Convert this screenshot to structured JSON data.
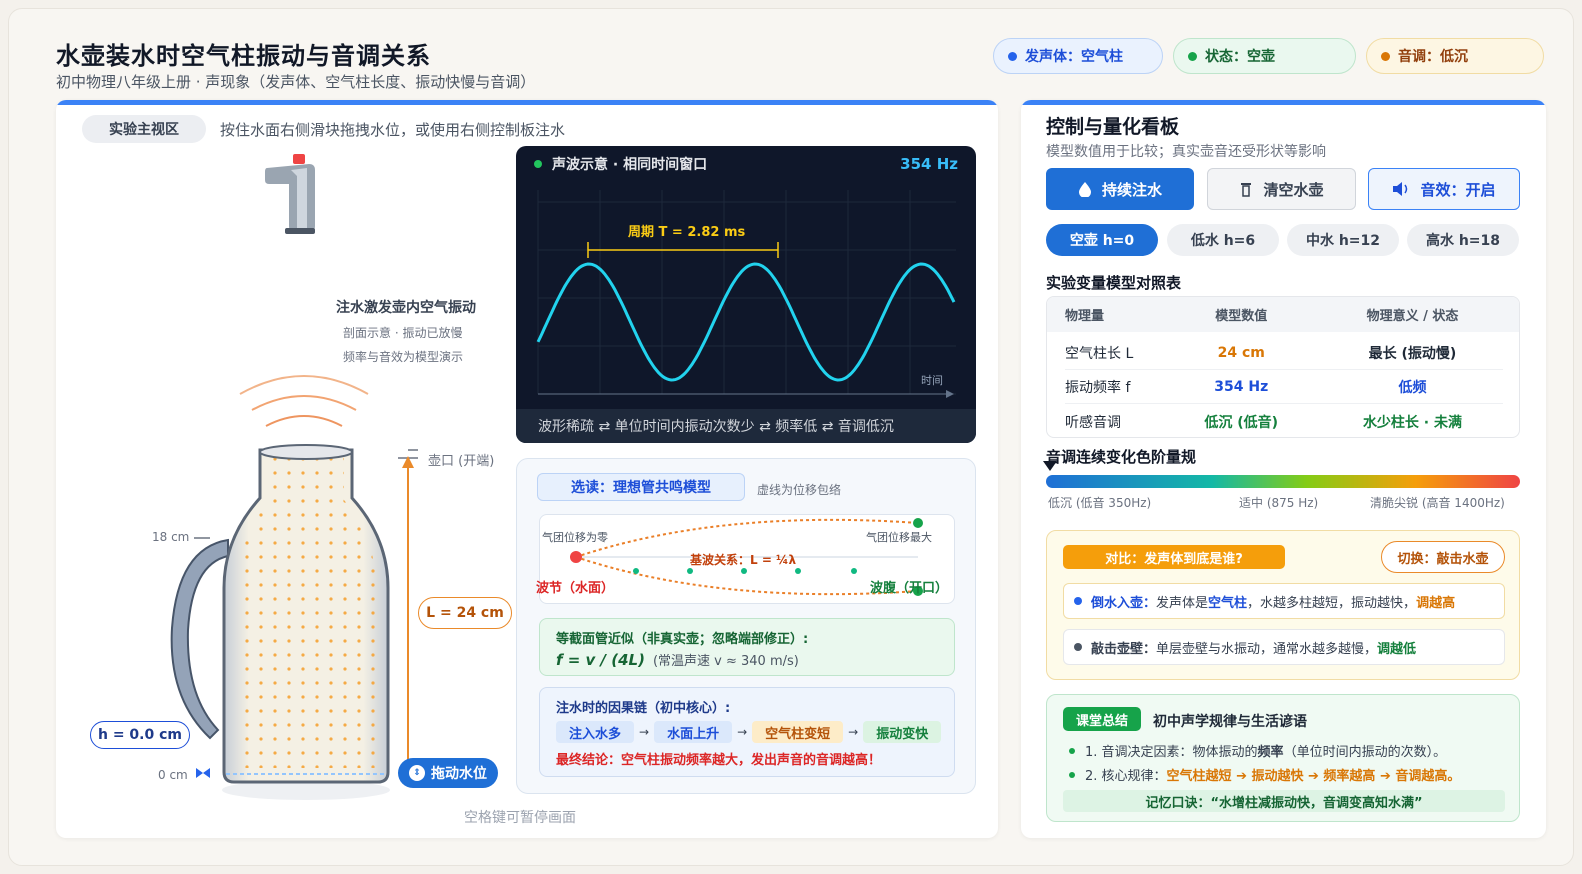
{
  "header": {
    "title": "水壶装水时空气柱振动与音调关系",
    "subtitle": "初中物理八年级上册 · 声现象（发声体、空气柱长度、振动快慢与音调）",
    "chips": [
      {
        "label": "发声体：空气柱",
        "color": "#2563eb"
      },
      {
        "label": "状态：空壶",
        "color": "#16a34a"
      },
      {
        "label": "音调：低沉",
        "color": "#d97706"
      }
    ]
  },
  "main": {
    "label": "实验主视区",
    "hint": "按住水面右侧滑块拖拽水位，或使用右侧控制板注水",
    "desc_title": "注水激发壶内空气振动",
    "desc_line1": "剖面示意 · 振动已放慢",
    "desc_line2": "频率与音效为模型演示",
    "label_mouth": "壶口 (开端)",
    "label_18": "18 cm",
    "label_0": "0 cm",
    "h_value": "h = 0.0 cm",
    "L_value": "L = 24 cm",
    "drag_label": "拖动水位",
    "pause_hint": "空格键可暂停画面",
    "scope": {
      "title": "声波示意 · 相同时间窗口",
      "freq": "354 Hz",
      "period": "周期 T = 2.82 ms",
      "time_label": "时间",
      "footer": "波形稀疏 ⇄ 单位时间内振动次数少 ⇄ 频率低 ⇄ 音调低沉",
      "frequency_hz": 354,
      "cycles_shown": 2.5
    },
    "model": {
      "tag": "选读：理想管共鸣模型",
      "note": "虚线为位移包络",
      "left_top": "气团位移为零",
      "right_top": "气团位移最大",
      "relation": "基波关系：L = ¼λ",
      "node": "波节（水面）",
      "antinode": "波腹（开口）",
      "formula_title": "等截面管近似（非真实壶；忽略端部修正）:",
      "formula": "f = v / (4L)",
      "formula_note": "(常温声速 v ≈ 340 m/s)",
      "chain_title": "注水时的因果链（初中核心）:",
      "steps": [
        "注入水多",
        "水面上升",
        "空气柱变短",
        "振动变快"
      ],
      "conclusion": "最终结论：空气柱振动频率越大，发出声音的音调越高！"
    }
  },
  "panel": {
    "title": "控制与量化看板",
    "subtitle": "模型数值用于比较；真实壶音还受形状等影响",
    "btn_fill": "持续注水",
    "btn_empty": "清空水壶",
    "btn_sound": "音效：开启",
    "levels": [
      "空壶 h=0",
      "低水 h=6",
      "中水 h=12",
      "高水 h=18"
    ],
    "table_title": "实验变量模型对照表",
    "table_headers": [
      "物理量",
      "模型数值",
      "物理意义 / 状态"
    ],
    "table_rows": [
      {
        "name": "空气柱长 L",
        "value": "24 cm",
        "meaning": "最长 (振动慢)",
        "value_color": "#d97706",
        "meaning_color": "#1f2937"
      },
      {
        "name": "振动频率 f",
        "value": "354 Hz",
        "meaning": "低频",
        "value_color": "#1d4ed8",
        "meaning_color": "#1d4ed8"
      },
      {
        "name": "听感音调",
        "value": "低沉 (低音)",
        "meaning": "水少柱长 · 未满",
        "value_color": "#15803d",
        "meaning_color": "#15803d"
      }
    ],
    "gradient_title": "音调连续变化色阶量规",
    "gradient_labels": [
      "低沉 (低音 350Hz)",
      "适中 (875 Hz)",
      "清脆尖锐 (高音 1400Hz)"
    ],
    "compare": {
      "tag": "对比：发声体到底是谁?",
      "switch": "切换：敲击水壶",
      "item1": {
        "a": "倒水入壶：",
        "b": "发声体是",
        "c": "空气柱",
        "d": "，水越多柱越短，振动越快，",
        "e": "调越高"
      },
      "item2": {
        "a": "敲击壶壁：",
        "b": "单层壶壁与水振动，通常水越多越慢，",
        "e": "调越低"
      }
    },
    "summary": {
      "tag": "课堂总结",
      "title": "初中声学规律与生活谚语",
      "line1_a": "1. 音调决定因素：物体振动的",
      "line1_b": "频率",
      "line1_c": "（单位时间内振动的次数）。",
      "line2_a": "2. 核心规律：",
      "line2_b": "空气柱越短 ➔ 振动越快 ➔ 频率越高 ➔ 音调越高。",
      "motto": "记忆口诀：“水增柱减振动快，音调变高知水满”"
    }
  }
}
